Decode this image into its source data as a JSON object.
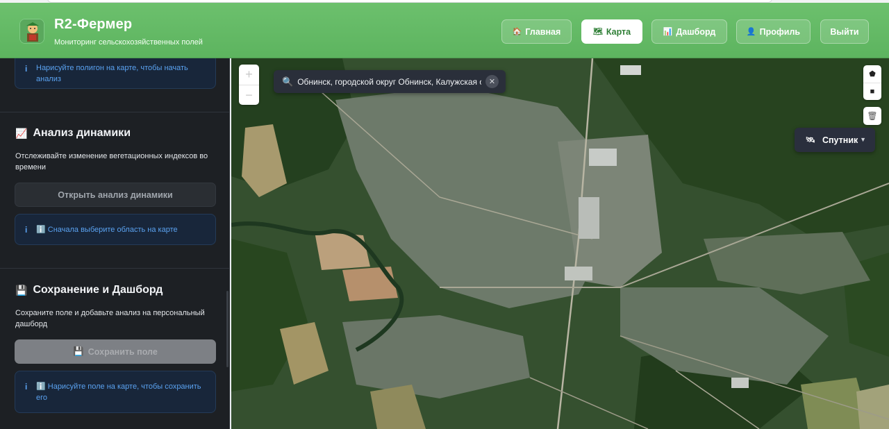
{
  "header": {
    "title": "R2-Фермер",
    "subtitle": "Мониторинг сельскохозяйственных полей",
    "nav": [
      {
        "icon": "house-icon",
        "glyph": "🏠",
        "label": "Главная",
        "active": false
      },
      {
        "icon": "map-book-icon",
        "glyph": "🗺",
        "label": "Карта",
        "active": true
      },
      {
        "icon": "chart-icon",
        "glyph": "📊",
        "label": "Дашборд",
        "active": false
      },
      {
        "icon": "user-icon",
        "glyph": "👤",
        "label": "Профиль",
        "active": false
      }
    ],
    "logout_label": "Выйти"
  },
  "sidebar": {
    "top_info": "Нарисуйте полигон на карте, чтобы начать анализ",
    "dynamics": {
      "emoji": "📈",
      "title": "Анализ динамики",
      "description": "Отслеживайте изменение вегетационных индексов во времени",
      "button_label": "Открыть анализ динамики",
      "info": "ℹ️ Сначала выберите область на карте"
    },
    "save": {
      "emoji": "💾",
      "title": "Сохранение и Дашборд",
      "description": "Сохраните поле и добавьте анализ на персональный дашборд",
      "button_icon": "💾",
      "button_label": "Сохранить поле",
      "info": "ℹ️ Нарисуйте поле на карте, чтобы сохранить его"
    }
  },
  "map": {
    "search_value": "Обнинск, городской округ Обнинск, Калужская область",
    "zoom_in": "+",
    "zoom_out": "−",
    "layer_label": "Спутник",
    "layer_caret": "▼"
  },
  "colors": {
    "header_green": "#5db45f",
    "sidebar_bg": "#1d2024",
    "info_text": "#5aa2f0"
  }
}
